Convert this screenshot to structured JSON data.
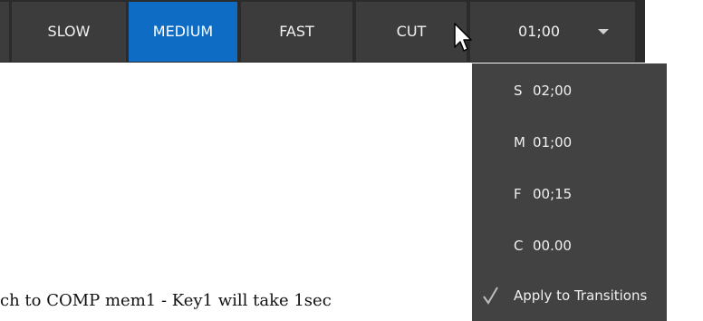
{
  "toolbar": {
    "buttons": [
      {
        "label": "SLOW",
        "active": false
      },
      {
        "label": "MEDIUM",
        "active": true
      },
      {
        "label": "FAST",
        "active": false
      },
      {
        "label": "CUT",
        "active": false
      }
    ],
    "duration_value": "01;00",
    "active_color": "#0e6cc4"
  },
  "duration_menu": {
    "items": [
      {
        "letter": "S",
        "time": "02;00"
      },
      {
        "letter": "M",
        "time": "01;00"
      },
      {
        "letter": "F",
        "time": "00;15"
      },
      {
        "letter": "C",
        "time": "00.00"
      }
    ],
    "apply_label": "Apply to Transitions",
    "apply_checked": true
  },
  "caption": "ch to COMP mem1 - Key1 will take 1sec",
  "icons": [
    "chevron-down-icon",
    "mouse-pointer-icon",
    "checkmark-icon"
  ]
}
